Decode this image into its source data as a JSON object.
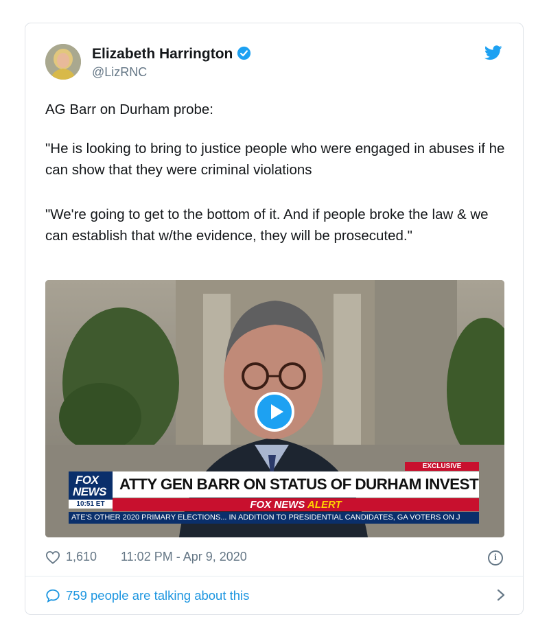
{
  "author": {
    "name": "Elizabeth Harrington",
    "handle": "@LizRNC"
  },
  "tweet": {
    "line1": "AG Barr on Durham probe:",
    "line2": "\"He is looking to bring to justice people who were engaged in abuses if he can show that they were criminal violations",
    "line3": "\"We're going to get to the bottom of it. And if people broke the law & we can establish that w/the evidence, they will be prosecuted.\""
  },
  "video": {
    "logo_line1": "FOX",
    "logo_line2": "NEWS",
    "time": "10:51 ET",
    "exclusive": "EXCLUSIVE",
    "headline": "ATTY GEN BARR ON STATUS OF DURHAM INVESTIGATION",
    "alert_brand": "FOX NEWS",
    "alert_word": "ALERT",
    "crawl": "ATE'S OTHER 2020 PRIMARY ELECTIONS...   IN ADDITION TO PRESIDENTIAL CANDIDATES, GA VOTERS ON J"
  },
  "stats": {
    "likes": "1,610",
    "timestamp": "11:02 PM - Apr 9, 2020"
  },
  "conversation": {
    "text": "759 people are talking about this"
  },
  "colors": {
    "accent": "#1da1f2",
    "link": "#1b95e0",
    "muted": "#657786",
    "fox_red": "#c8102e",
    "fox_blue": "#0a2f6b"
  },
  "icons": [
    "verified-badge-icon",
    "twitter-bird-icon",
    "play-icon",
    "heart-icon",
    "info-icon",
    "speech-bubble-icon",
    "chevron-right-icon"
  ]
}
